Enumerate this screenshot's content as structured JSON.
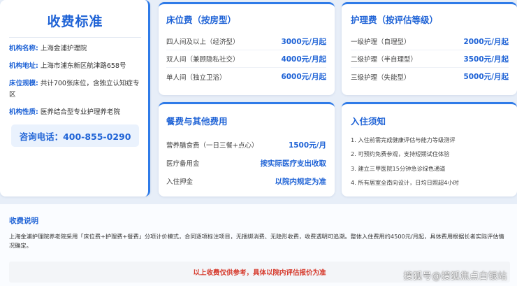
{
  "info": {
    "title": "收费标准",
    "rows": [
      {
        "label": "机构名称:",
        "value": "上海金浦护理院"
      },
      {
        "label": "机构地址:",
        "value": "上海市浦东新区航津路658号"
      },
      {
        "label": "床位规模:",
        "value": "共计700张床位，含独立认知症专区"
      },
      {
        "label": "机构性质:",
        "value": "医养结合型专业护理养老院"
      }
    ],
    "phone": "咨询电话：400-855-0290"
  },
  "bed": {
    "title": "床位费（按房型）",
    "rows": [
      {
        "name": "四人间及以上（经济型）",
        "price": "3000元/月起"
      },
      {
        "name": "双人间（兼顾隐私社交）",
        "price": "4000元/月起"
      },
      {
        "name": "单人间（独立卫浴）",
        "price": "6000元/月起"
      }
    ]
  },
  "care": {
    "title": "护理费（按评估等级）",
    "rows": [
      {
        "name": "一级护理（自理型）",
        "price": "2000元/月起"
      },
      {
        "name": "二级护理（半自理型）",
        "price": "3500元/月起"
      },
      {
        "name": "三级护理（失能型）",
        "price": "5000元/月起"
      }
    ]
  },
  "meal": {
    "title": "餐费与其他费用",
    "rows": [
      {
        "name": "营养膳食费（一日三餐+点心）",
        "price": "1500元/月"
      },
      {
        "name": "医疗备用金",
        "price": "按实际医疗支出收取"
      },
      {
        "name": "入住押金",
        "price": "以院内规定为准"
      }
    ]
  },
  "notice": {
    "title": "入住须知",
    "items": [
      "1. 入住前需完成健康评估与能力等级测评",
      "2. 可预约免费参观，支持短期试住体验",
      "3. 建立三甲医院15分钟急诊绿色通道",
      "4. 所有居室全南向设计，日均日照超4小时"
    ]
  },
  "bottom": {
    "title": "收费说明",
    "text": "上海金浦护理院养老院采用「床位费+护理费+餐费」分项计价模式，合同逐项标注项目，无捆绑消费、无隐形收费，收费透明可追溯。整体入住费用约4500元/月起，具体费用根据长者实际评估情况确定。",
    "disclaimer": "以上收费仅供参考，具体以院内评估报价为准"
  },
  "watermark": "搜狐号@搜狐焦点白银站",
  "colors": {
    "accent": "#1f63d6",
    "border_accent": "#2f7be8",
    "warning": "#d63a2c"
  }
}
